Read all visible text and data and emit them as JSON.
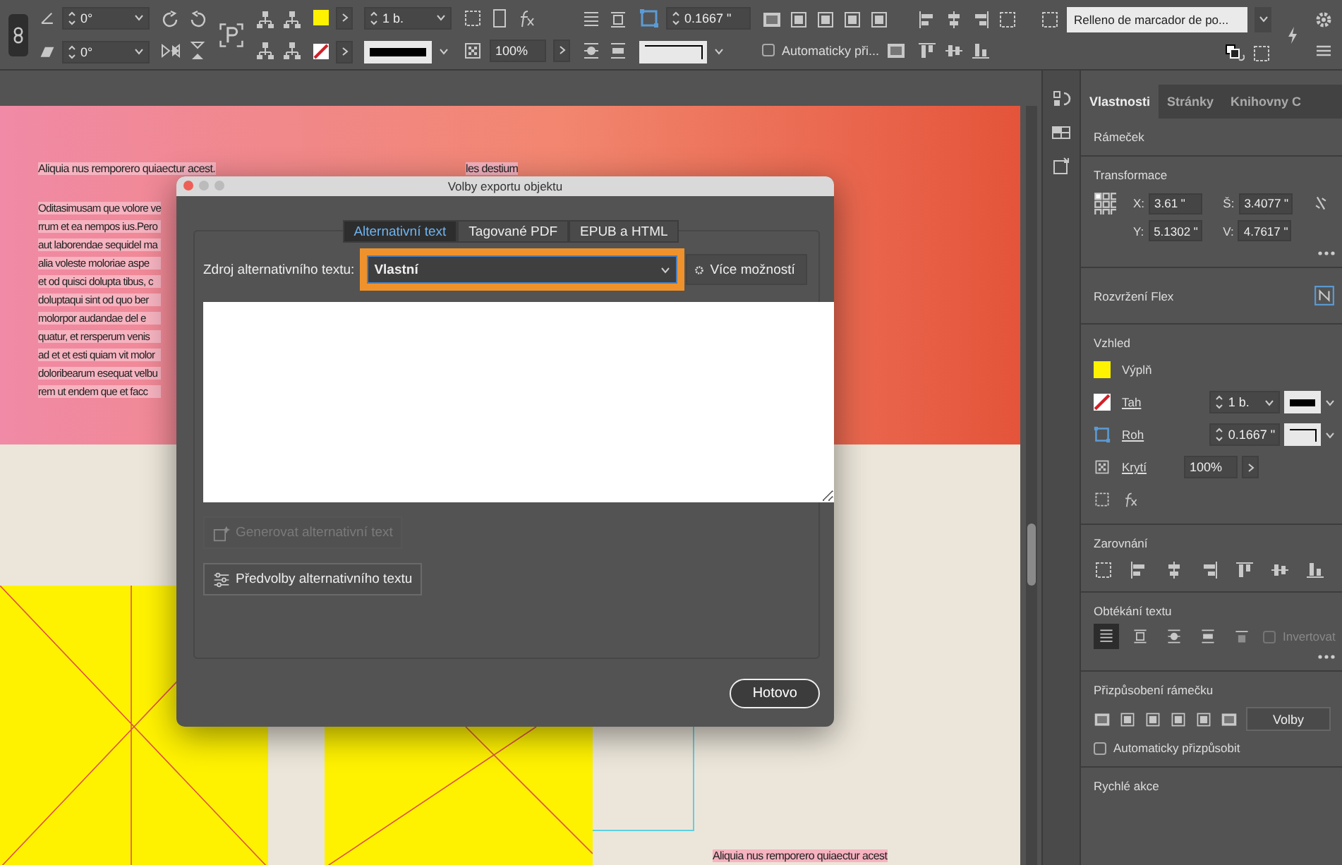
{
  "toolbar": {
    "rotation_angle": "0°",
    "shear_angle": "0°",
    "stroke_weight": "1 b.",
    "opacity": "100%",
    "corner_size": "0.1667 \"",
    "auto_fit": {
      "label": "Automaticky při...",
      "checked": false
    },
    "style_dropdown": "Relleno de marcador de po..."
  },
  "canvas": {
    "caption_top": "Aliquia nus remporero quiaectur acest.",
    "body_lines": [
      "Oditasimusam que volore ve",
      "rrum et ea nempos ius.Pero",
      "aut laborendae sequidel ma",
      "alia voleste moloriae aspe",
      "et od quisci dolupta tibus, c",
      "doluptaqui sint od quo ber",
      "molorpor audandae del e",
      "quatur, et rersperum venis",
      "ad et et esti quiam vit molor",
      "doloribearum esequat velbu",
      "rem ut endem que et facc"
    ],
    "side_text": "les destium",
    "caption_bottom": "Aliquia nus remporero quiaectur acest"
  },
  "dialog": {
    "title": "Volby exportu objektu",
    "tabs": [
      {
        "label": "Alternativní text",
        "selected": true
      },
      {
        "label": "Tagované PDF",
        "selected": false
      },
      {
        "label": "EPUB a HTML",
        "selected": false
      }
    ],
    "source_label": "Zdroj alternativního textu:",
    "source_value": "Vlastní",
    "more_button": "Více možností",
    "generate_button": {
      "label": "Generovat alternativní text",
      "disabled": true
    },
    "presets_button": "Předvolby alternativního textu",
    "done_button": "Hotovo"
  },
  "panel": {
    "tabs": [
      {
        "label": "Vlastnosti",
        "selected": true
      },
      {
        "label": "Stránky",
        "selected": false
      },
      {
        "label": "Knihovny C",
        "selected": false
      }
    ],
    "frame_title": "Rámeček",
    "transform": {
      "title": "Transformace",
      "fields": [
        {
          "label": "X:",
          "value": "3.61 \""
        },
        {
          "label": "Š:",
          "value": "3.4077 \""
        },
        {
          "label": "Y:",
          "value": "5.1302 \""
        },
        {
          "label": "V:",
          "value": "4.7617 \""
        }
      ]
    },
    "flex_title": "Rozvržení Flex",
    "appearance": {
      "title": "Vzhled",
      "fill_label": "Výplň",
      "stroke_label": "Tah",
      "stroke_weight": "1 b.",
      "corner_label": "Roh",
      "corner_size": "0.1667 \"",
      "opacity_label": "Krytí",
      "opacity": "100%"
    },
    "align_title": "Zarovnání",
    "wrap": {
      "title": "Obtékání textu",
      "options": [
        {
          "selected": true
        },
        {
          "selected": false
        },
        {
          "selected": false
        },
        {
          "selected": false
        },
        {
          "selected": false
        }
      ],
      "invert": {
        "label": "Invertovat",
        "checked": false,
        "disabled": true
      }
    },
    "fitting": {
      "title": "Přizpůsobení rámečku",
      "options_button": "Volby",
      "auto_fit": {
        "label": "Automaticky přizpůsobit",
        "checked": false
      }
    },
    "quick_actions_title": "Rychlé akce"
  }
}
